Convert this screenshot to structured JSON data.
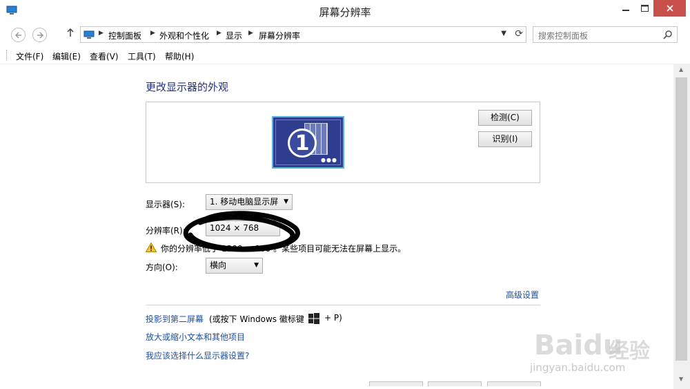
{
  "window": {
    "title": "屏幕分辨率"
  },
  "address": {
    "crumbs": [
      "控制面板",
      "外观和个性化",
      "显示",
      "屏幕分辨率"
    ],
    "search_placeholder": "搜索控制面板"
  },
  "menu": [
    "文件(F)",
    "编辑(E)",
    "查看(V)",
    "工具(T)",
    "帮助(H)"
  ],
  "main": {
    "heading": "更改显示器的外观",
    "monitor_number": "1",
    "detect_button": "检测(C)",
    "identify_button": "识别(I)",
    "display_label": "显示器(S):",
    "display_value": "1. 移动电脑显示屏",
    "resolution_label": "分辨率(R):",
    "resolution_value": "1024 × 768",
    "warning_prefix": "你的分辨率低于",
    "warning_value": "1200 × 900",
    "warning_suffix": "。某些项目可能无法在屏幕上显示。",
    "orientation_label": "方向(O):",
    "orientation_value": "横向",
    "advanced_link": "高级设置",
    "project_link": "投影到第二屏幕",
    "project_hint": "(或按下 Windows 徽标键",
    "project_hint_end": "+ P)",
    "text_size_link": "放大或缩小文本和其他项目",
    "which_settings_link": "我应该选择什么显示器设置?"
  },
  "watermark": {
    "brand": "Baidu",
    "brand_cn": "经验",
    "url": "jingyan.baidu.com"
  }
}
